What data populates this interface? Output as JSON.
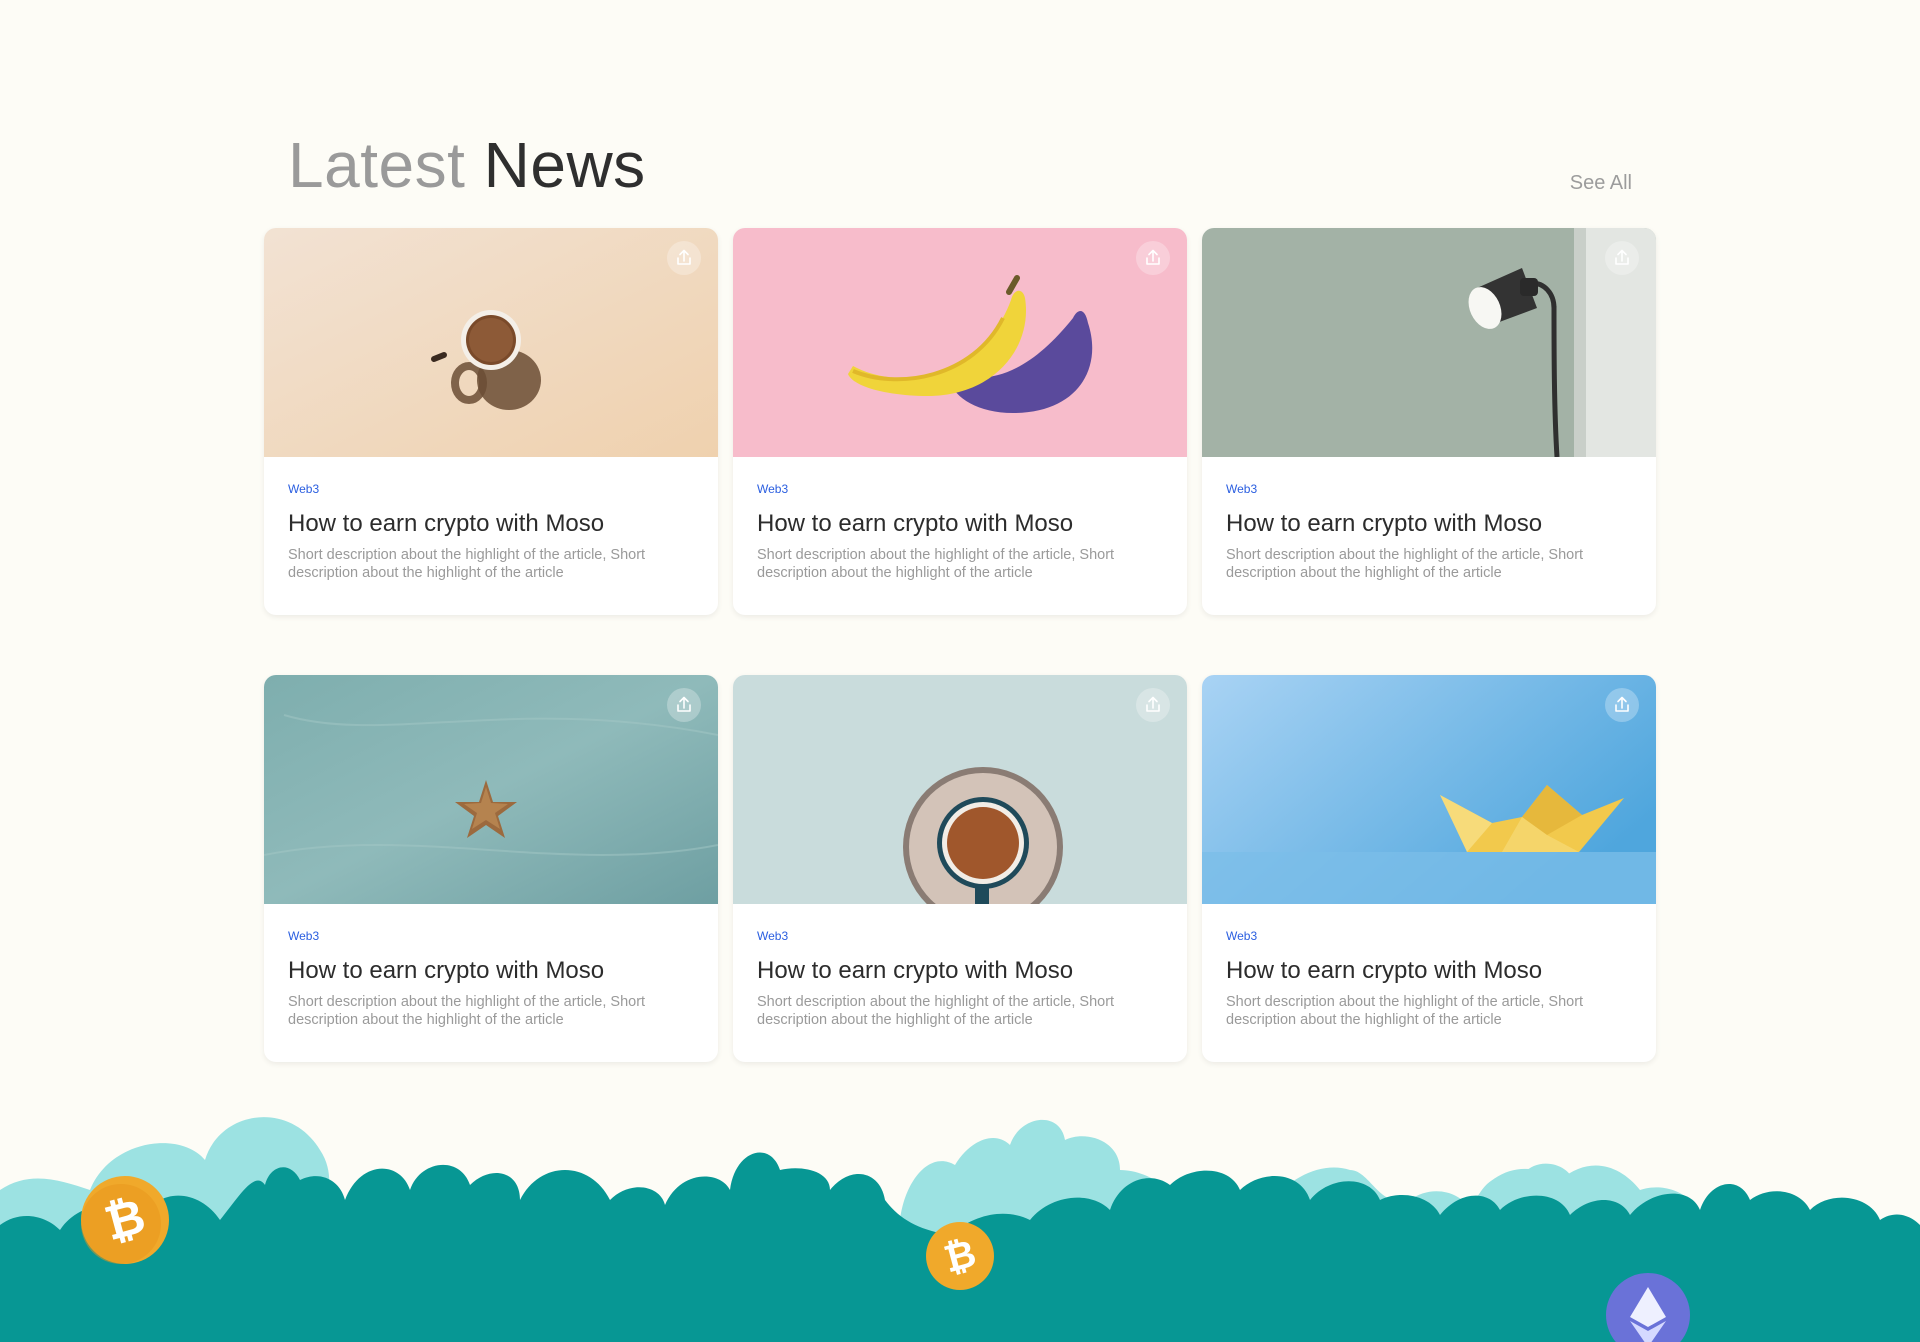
{
  "heading": {
    "title_light": "Latest",
    "title_dark": "News",
    "see_all": "See All"
  },
  "cards": [
    {
      "tag": "Web3",
      "title": "How to earn crypto with Moso",
      "description": "Short description about the highlight of the article, Short description about the highlight of the article",
      "image": "coffee-mug-on-beige"
    },
    {
      "tag": "Web3",
      "title": "How to earn crypto with Moso",
      "description": "Short description about the highlight of the article, Short description about the highlight of the article",
      "image": "banana-on-pink"
    },
    {
      "tag": "Web3",
      "title": "How to earn crypto with Moso",
      "description": "Short description about the highlight of the article, Short description about the highlight of the article",
      "image": "floor-lamp-on-sage"
    },
    {
      "tag": "Web3",
      "title": "How to earn crypto with Moso",
      "description": "Short description about the highlight of the article, Short description about the highlight of the article",
      "image": "starfish-on-sand"
    },
    {
      "tag": "Web3",
      "title": "How to earn crypto with Moso",
      "description": "Short description about the highlight of the article, Short description about the highlight of the article",
      "image": "coffee-cup-on-saucer"
    },
    {
      "tag": "Web3",
      "title": "How to earn crypto with Moso",
      "description": "Short description about the highlight of the article, Short description about the highlight of the article",
      "image": "paper-boat-on-blue"
    }
  ],
  "icons": {
    "share": "share-upload-icon",
    "bitcoin": "bitcoin-coin-icon",
    "ethereum": "ethereum-coin-icon"
  },
  "colors": {
    "background": "#fdfcf6",
    "tag": "#2a5ee0",
    "foliage_dark": "#079794",
    "foliage_light": "#9ce2e2",
    "bitcoin": "#f0a92b",
    "ethereum": "#6a72d8"
  }
}
